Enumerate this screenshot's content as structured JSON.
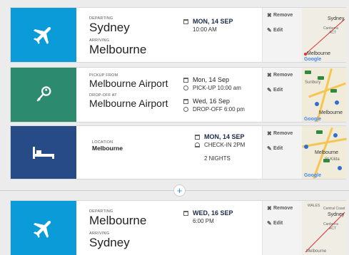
{
  "colors": {
    "flight": "#0b9bd8",
    "car": "#2c8a6f",
    "hotel": "#274b86",
    "accent": "#2a8fd9"
  },
  "actions": {
    "remove": "Remove",
    "edit": "Edit"
  },
  "flight1": {
    "icon": "airplane-icon",
    "depart_label": "DEPARTING",
    "depart_city": "Sydney",
    "arrive_label": "ARRIVING",
    "arrive_city": "Melbourne",
    "date": "MON, 14 SEP",
    "time": "10:00 AM",
    "map": {
      "sydney": "Sydney",
      "canberra": "Canberra",
      "act": "ACT",
      "melbourne": "Melbourne",
      "google": "Google"
    }
  },
  "car": {
    "icon": "key-icon",
    "pickup_label": "PICKUP FROM",
    "pickup_place": "Melbourne Airport",
    "dropoff_label": "DROP-OFF AT",
    "dropoff_place": "Melbourne Airport",
    "pickup_date": "Mon, 14 Sep",
    "pickup_time": "PICK-UP 10:00 am",
    "dropoff_date": "Wed, 16 Sep",
    "dropoff_time": "DROP-OFF 6:00 pm",
    "map": {
      "sunbury": "Sunbury",
      "melbourne": "Melbourne",
      "google": "Google"
    }
  },
  "hotel": {
    "icon": "bed-icon",
    "location_label": "LOCATION",
    "location": "Melbourne",
    "date": "MON, 14 SEP",
    "checkin": "CHECK-IN 2PM",
    "nights": "2 NIGHTS",
    "map": {
      "melbourne": "Melbourne",
      "stkilda": "St Kilda",
      "google": "Google"
    }
  },
  "add_label": "+",
  "flight2": {
    "icon": "airplane-icon",
    "depart_label": "DEPARTING",
    "depart_city": "Melbourne",
    "arrive_label": "ARRIVING",
    "arrive_city": "Sydney",
    "date": "WED, 16 SEP",
    "time": "6:00 PM",
    "map": {
      "wales": "WALES",
      "coast": "Central Coast",
      "sydney": "Sydney",
      "canberra": "Canberra",
      "act": "ACT",
      "melbourne": "Melbourne"
    }
  }
}
